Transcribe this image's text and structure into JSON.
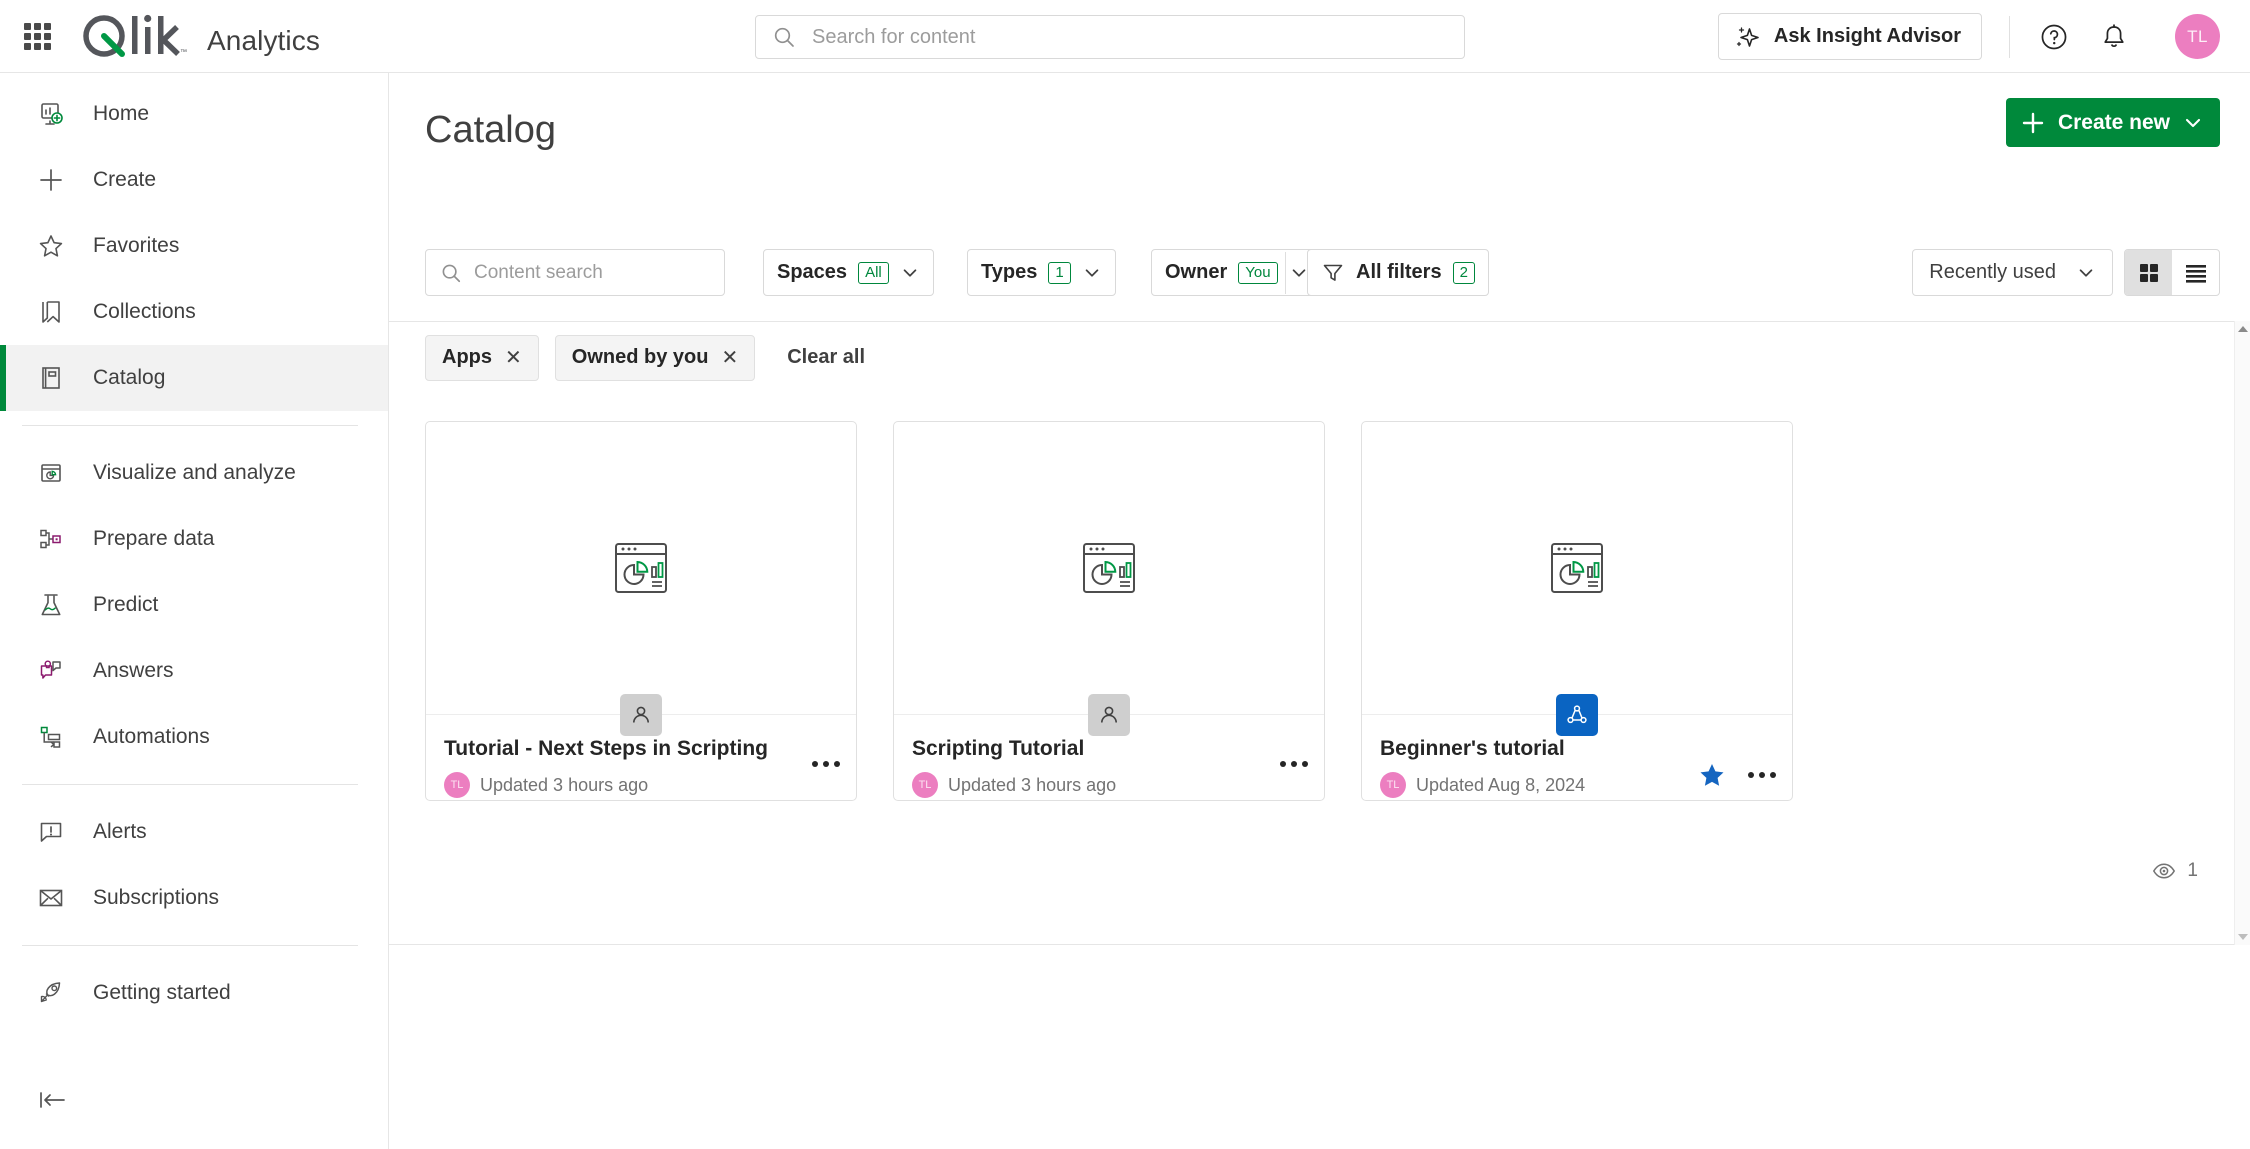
{
  "header": {
    "app_menu_icon": "waffle-grid-icon",
    "logo_text": "Qlik",
    "product": "Analytics",
    "search": {
      "icon": "search-icon",
      "placeholder": "Search for content",
      "value": ""
    },
    "ask_insight_advisor": "Ask Insight Advisor",
    "ask_icon": "sparkle-icon",
    "help_icon": "help-circle-icon",
    "notifications_icon": "bell-icon",
    "avatar_initials": "TL",
    "avatar_color": "#ec7ec0"
  },
  "sidebar": {
    "items": [
      {
        "label": "Home",
        "icon": "home-dashboard-icon",
        "active": false
      },
      {
        "label": "Create",
        "icon": "plus-icon",
        "active": false
      },
      {
        "label": "Favorites",
        "icon": "star-outline-icon",
        "active": false
      },
      {
        "label": "Collections",
        "icon": "bookmark-icon",
        "active": false
      },
      {
        "label": "Catalog",
        "icon": "catalog-book-icon",
        "active": true
      },
      {
        "label": "Visualize and analyze",
        "icon": "chart-window-icon",
        "active": false
      },
      {
        "label": "Prepare data",
        "icon": "data-nodes-icon",
        "active": false
      },
      {
        "label": "Predict",
        "icon": "flask-icon",
        "active": false
      },
      {
        "label": "Answers",
        "icon": "chat-bulb-icon",
        "active": false
      },
      {
        "label": "Automations",
        "icon": "automation-flow-icon",
        "active": false
      },
      {
        "label": "Alerts",
        "icon": "alert-speech-icon",
        "active": false
      },
      {
        "label": "Subscriptions",
        "icon": "envelope-icon",
        "active": false
      },
      {
        "label": "Getting started",
        "icon": "rocket-icon",
        "active": false
      }
    ],
    "collapse_icon": "collapse-left-icon"
  },
  "main": {
    "title": "Catalog",
    "create_new": {
      "label": "Create new",
      "plus_icon": "plus-icon",
      "chevron_icon": "chevron-down-icon",
      "color": "#00893b"
    },
    "filters": {
      "content_search": {
        "icon": "search-icon",
        "placeholder": "Content search",
        "value": ""
      },
      "buttons": [
        {
          "label": "Spaces",
          "badge": "All",
          "chevron": "chevron-down-icon"
        },
        {
          "label": "Types",
          "badge": "1",
          "chevron": "chevron-down-icon"
        },
        {
          "label": "Owner",
          "badge": "You",
          "chevron": "chevron-down-icon"
        }
      ],
      "all_filters": {
        "label": "All filters",
        "badge": "2",
        "icon": "funnel-icon"
      },
      "badge_color": "#00873d"
    },
    "sort": {
      "label": "Recently used",
      "chevron": "chevron-down-icon"
    },
    "view_toggle": {
      "grid": {
        "icon": "grid-view-icon",
        "selected": true
      },
      "list": {
        "icon": "list-view-icon",
        "selected": false
      }
    },
    "active_filter_chips": [
      {
        "label": "Apps",
        "remove_icon": "close-icon"
      },
      {
        "label": "Owned by you",
        "remove_icon": "close-icon"
      }
    ],
    "clear_all": "Clear all",
    "cards": [
      {
        "title": "Tutorial - Next Steps in Scripting",
        "updated": "Updated 3 hours ago",
        "owner_initials": "TL",
        "thumbnail_icon": "app-chart-window-icon",
        "space_badge": "personal-space-icon",
        "space_badge_type": "personal",
        "starred": false,
        "menu_icon": "more-options-icon"
      },
      {
        "title": "Scripting Tutorial",
        "updated": "Updated 3 hours ago",
        "owner_initials": "TL",
        "thumbnail_icon": "app-chart-window-icon",
        "space_badge": "personal-space-icon",
        "space_badge_type": "personal",
        "starred": false,
        "menu_icon": "more-options-icon"
      },
      {
        "title": "Beginner's tutorial",
        "updated": "Updated Aug 8, 2024",
        "owner_initials": "TL",
        "thumbnail_icon": "app-chart-window-icon",
        "space_badge": "shared-space-icon",
        "space_badge_type": "shared",
        "starred": true,
        "star_icon": "star-filled-icon",
        "star_color": "#1565c0",
        "menu_icon": "more-options-icon"
      }
    ],
    "views": {
      "icon": "eye-icon",
      "count": "1"
    }
  }
}
